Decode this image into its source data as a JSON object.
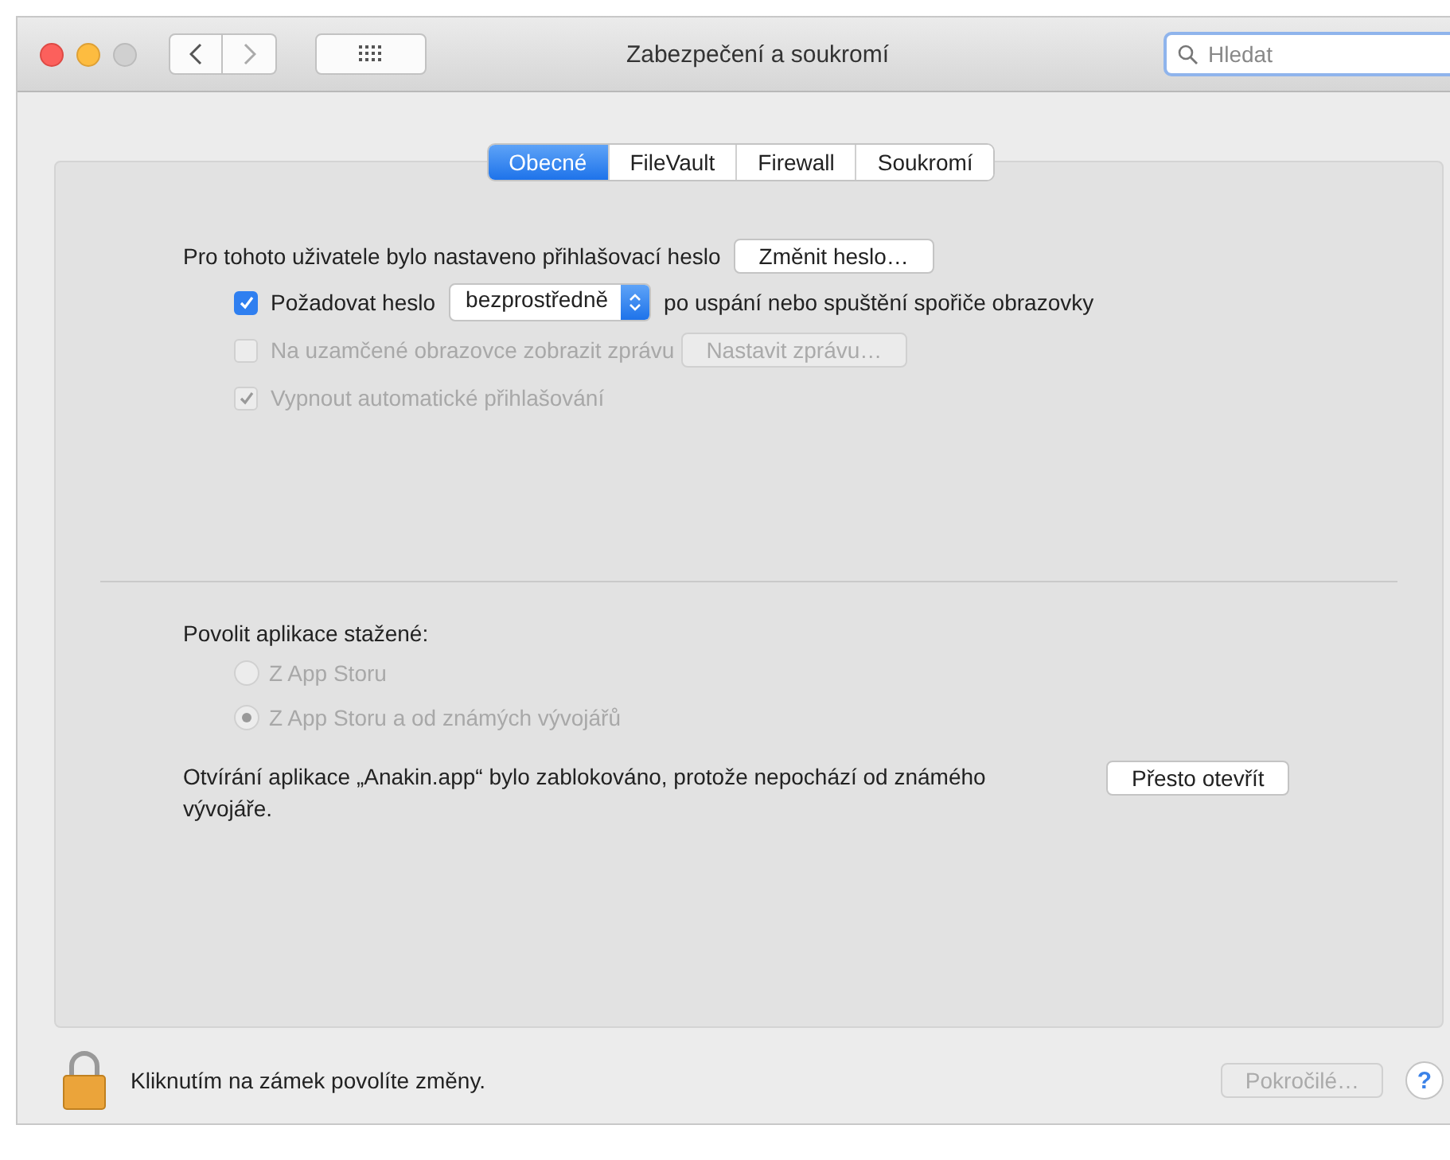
{
  "window": {
    "title": "Zabezpečení a soukromí"
  },
  "search": {
    "placeholder": "Hledat"
  },
  "tabs": [
    {
      "label": "Obecné",
      "selected": true
    },
    {
      "label": "FileVault",
      "selected": false
    },
    {
      "label": "Firewall",
      "selected": false
    },
    {
      "label": "Soukromí",
      "selected": false
    }
  ],
  "password": {
    "text": "Pro tohoto uživatele bylo nastaveno přihlašovací heslo",
    "button": "Změnit heslo…"
  },
  "options": [
    {
      "kind": "select",
      "label": "Požadovat heslo",
      "checked": true,
      "disabled": false,
      "value": "bezprostředně",
      "after": "po uspání nebo spuštění spořiče obrazovky"
    },
    {
      "kind": "button",
      "label": "Na uzamčené obrazovce zobrazit zprávu",
      "checked": false,
      "disabled": true,
      "button": "Nastavit zprávu…"
    },
    {
      "kind": "plain",
      "label": "Vypnout automatické přihlašování",
      "checked": true,
      "disabled": true
    }
  ],
  "downloads": {
    "label": "Povolit aplikace stažené:",
    "choices": [
      {
        "label": "Z App Storu",
        "selected": false,
        "disabled": true
      },
      {
        "label": "Z App Storu a od známých vývojářů",
        "selected": true,
        "disabled": true
      }
    ]
  },
  "blocked": {
    "text": "Otvírání aplikace „Anakin.app“ bylo zablokováno, protože nepochází od známého vývojáře.",
    "button": "Přesto otevřít"
  },
  "footer": {
    "lock_text": "Kliknutím na zámek povolíte změny.",
    "advanced": {
      "label": "Pokročilé…",
      "disabled": true
    },
    "help": "?"
  }
}
